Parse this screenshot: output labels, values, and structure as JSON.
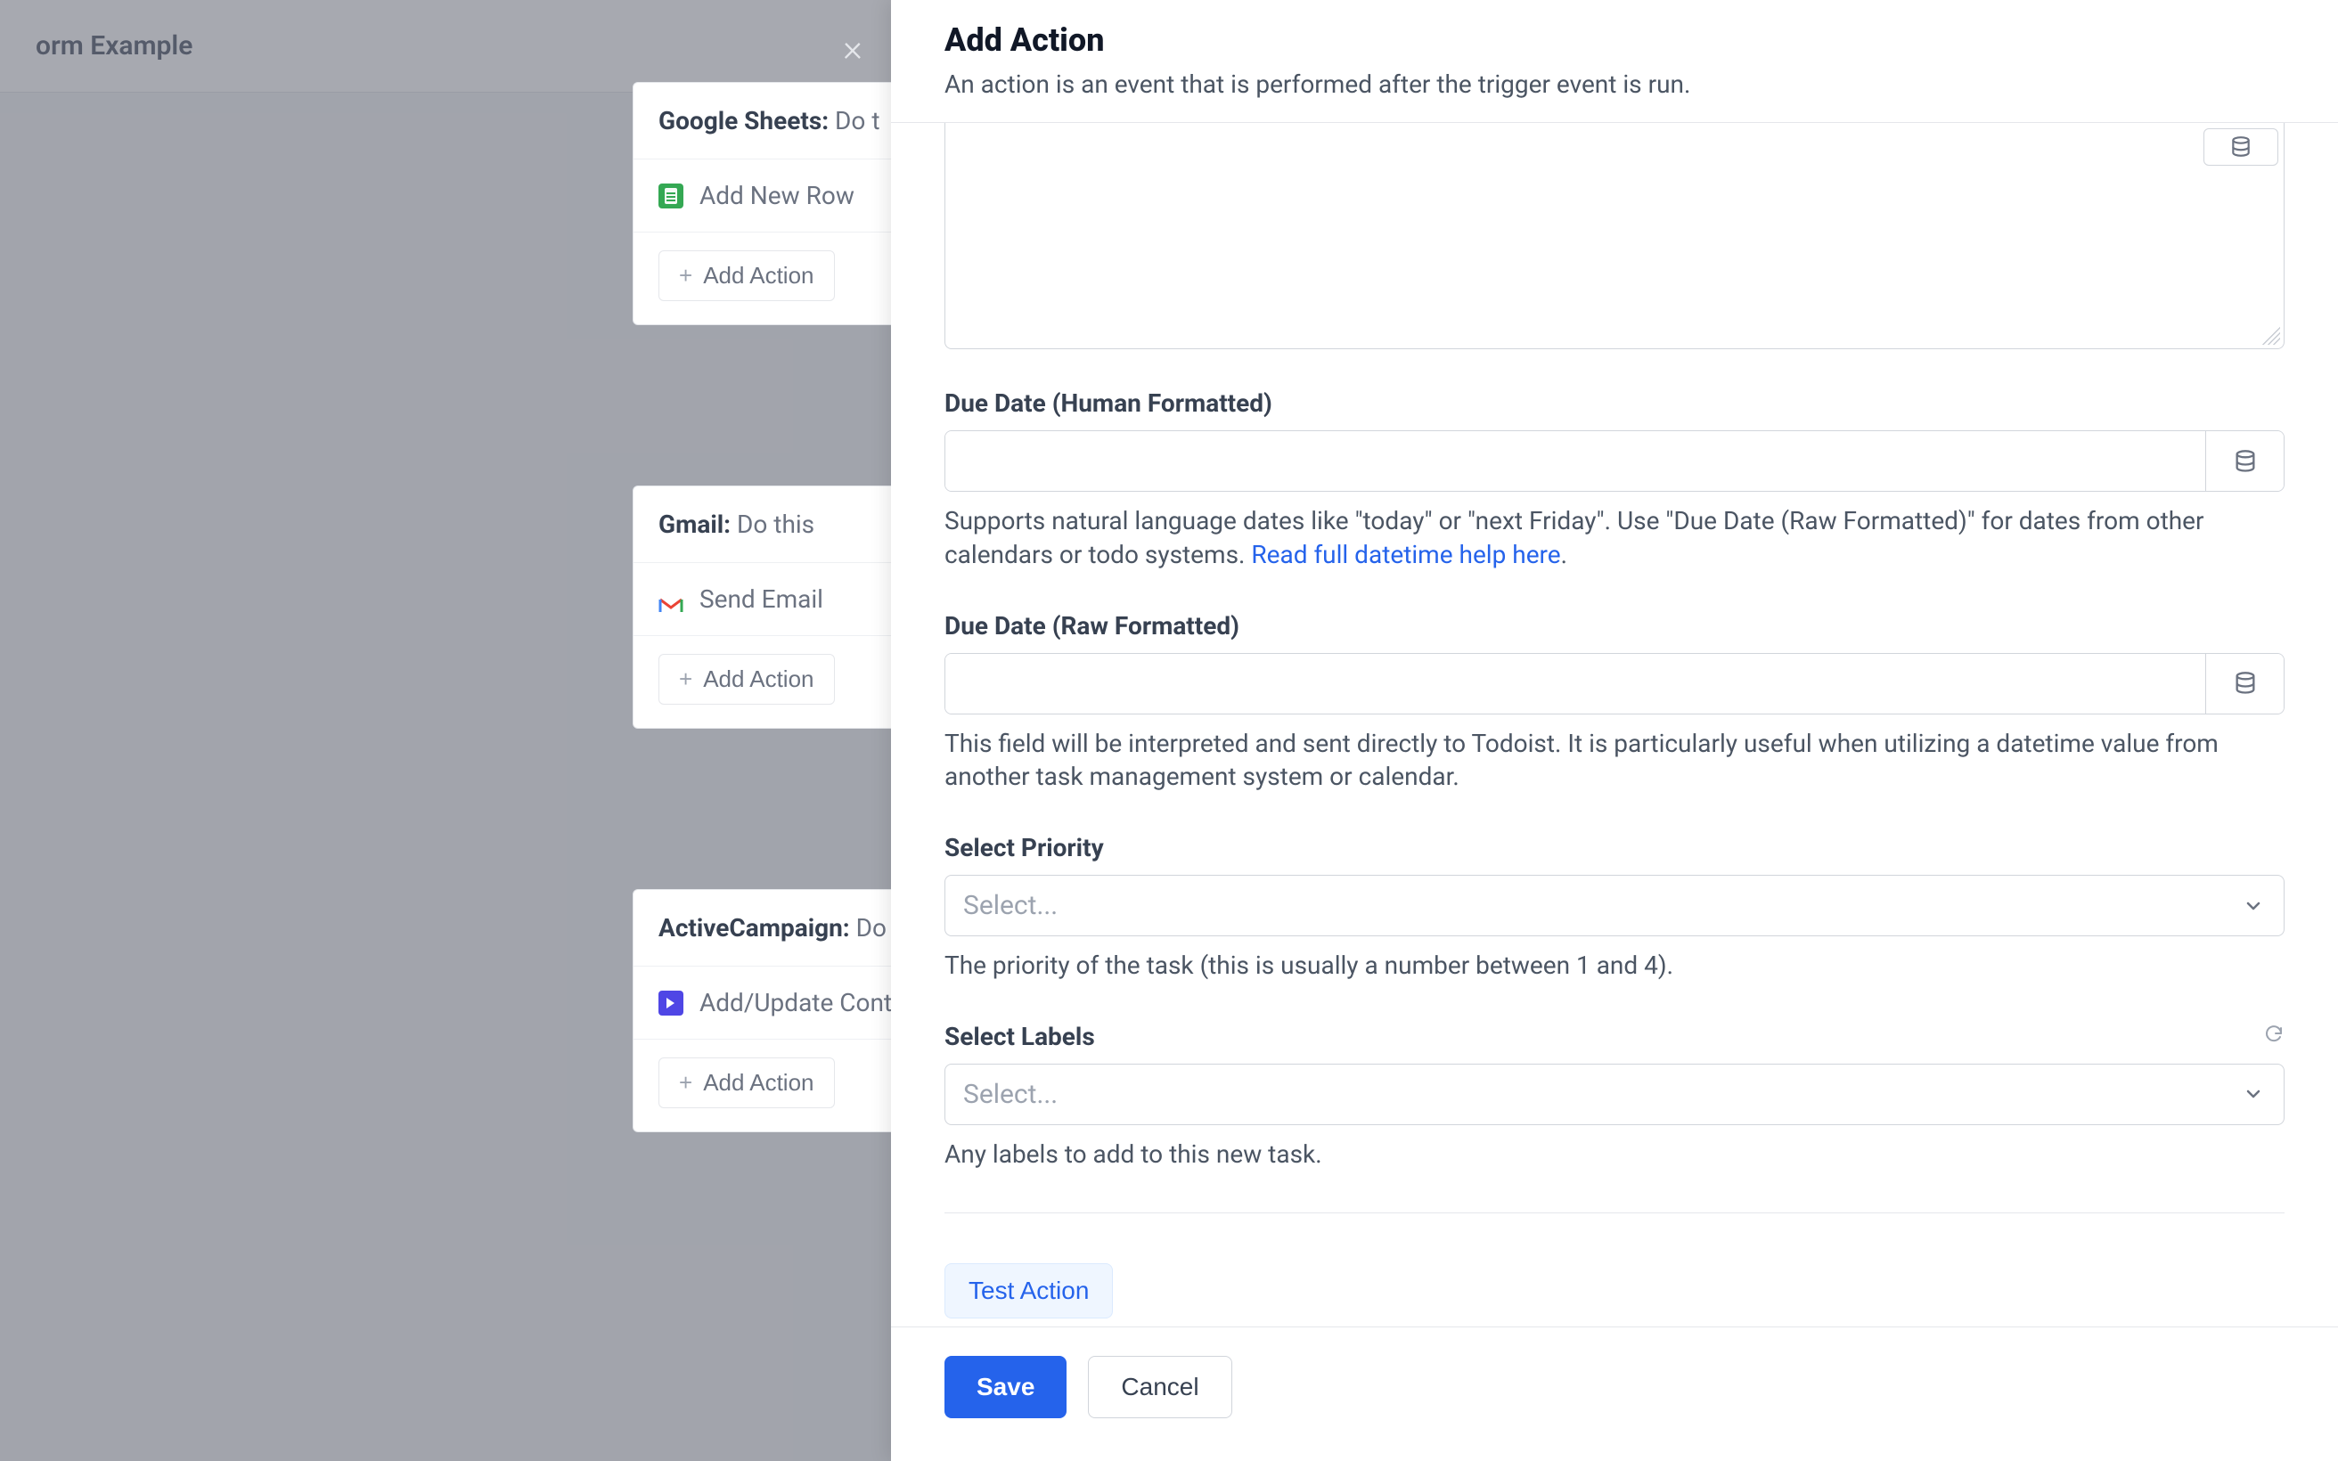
{
  "background": {
    "page_title_fragment": "orm Example",
    "cards": [
      {
        "app": "Google Sheets:",
        "subtitle": "Do t",
        "row_label": "Add New Row",
        "icon": "sheets",
        "add_label": "Add Action"
      },
      {
        "app": "Gmail:",
        "subtitle": "Do this",
        "row_label": "Send Email",
        "icon": "gmail",
        "add_label": "Add Action"
      },
      {
        "app": "ActiveCampaign:",
        "subtitle": "Do",
        "row_label": "Add/Update Conta",
        "icon": "activecampaign",
        "add_label": "Add Action"
      }
    ]
  },
  "panel": {
    "title": "Add Action",
    "description": "An action is an event that is performed after the trigger event is run.",
    "fields": {
      "due_human": {
        "label": "Due Date (Human Formatted)",
        "value": "",
        "help_pre": "Supports natural language dates like \"today\" or \"next Friday\". Use \"Due Date (Raw Formatted)\" for dates from other calendars or todo systems. ",
        "help_link": "Read full datetime help here",
        "help_post": "."
      },
      "due_raw": {
        "label": "Due Date (Raw Formatted)",
        "value": "",
        "help": "This field will be interpreted and sent directly to Todoist. It is particularly useful when utilizing a datetime value from another task management system or calendar."
      },
      "priority": {
        "label": "Select Priority",
        "placeholder": "Select...",
        "help": "The priority of the task (this is usually a number between 1 and 4)."
      },
      "labels": {
        "label": "Select Labels",
        "placeholder": "Select...",
        "help": "Any labels to add to this new task."
      }
    },
    "test_action": "Test Action",
    "save": "Save",
    "cancel": "Cancel"
  }
}
